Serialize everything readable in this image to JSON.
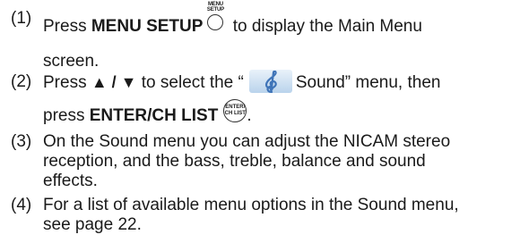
{
  "steps": [
    {
      "number": "(1)",
      "text_before": "Press ",
      "button": "MENU SETUP",
      "button_caption": [
        "MENU",
        "SETUP"
      ],
      "text_after": " to display the Main Menu",
      "text_line2": "screen."
    },
    {
      "number": "(2)",
      "text_before": "Press ",
      "arrows": "▲ / ▼",
      "text_middle": " to select the “",
      "menu_name": "Sound",
      "text_after": "” menu, then",
      "line2_before": "press ",
      "button": "ENTER/CH LIST",
      "button_caption": [
        "ENTER/",
        "CH LIST"
      ],
      "line2_after": "."
    },
    {
      "number": "(3)",
      "lines": [
        "On the Sound menu you can adjust the NICAM stereo",
        "reception, and the bass, treble, balance and sound",
        "effects."
      ]
    },
    {
      "number": "(4)",
      "lines": [
        "For a list of available menu options in the Sound menu,",
        "see page 22."
      ]
    }
  ],
  "icons": {
    "menu_setup": "circle-button-icon",
    "enter": "enter-button-icon",
    "sound": "treble-clef-icon"
  },
  "colors": {
    "text": "#1a1a1a",
    "icon_bg": "#cfe1f2",
    "icon_glyph": "#3f74b8"
  }
}
